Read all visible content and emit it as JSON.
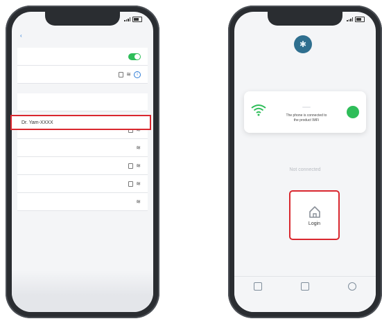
{
  "left_phone": {
    "highlighted_network": "Dr. Yam-XXXX"
  },
  "right_phone": {
    "connection_card": {
      "message_line1": "The phone is connected to",
      "message_line2": "the product WiFi"
    },
    "status_text": "Not connected",
    "login_label": "Login",
    "colors": {
      "accent_green": "#2ebd59",
      "highlight_red": "#d9272e"
    }
  }
}
